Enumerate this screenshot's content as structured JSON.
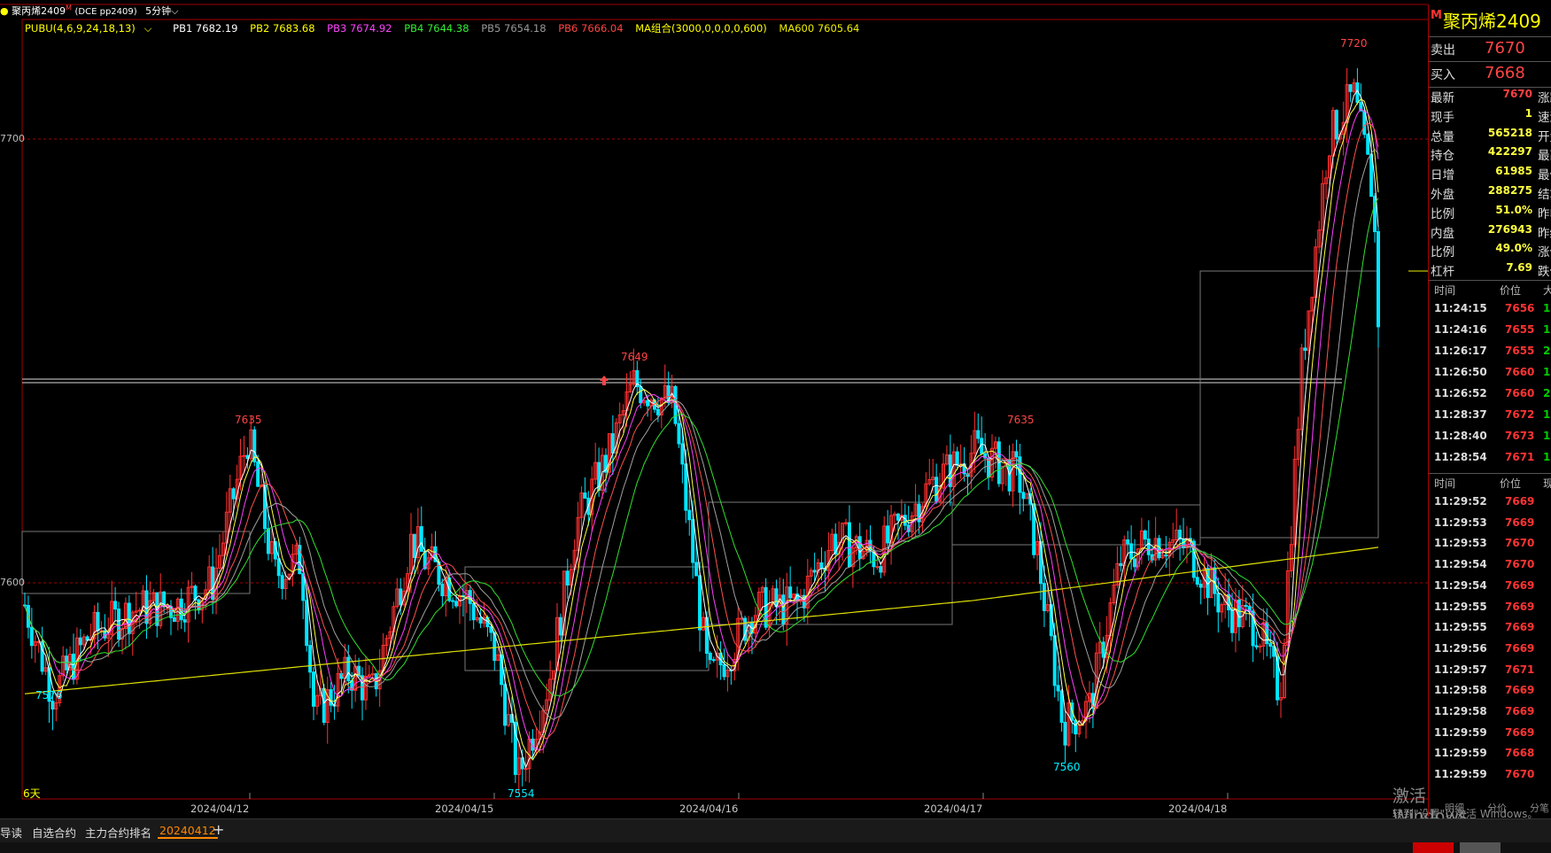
{
  "header": {
    "symbol_title": "聚丙烯2409",
    "code": "(DCE pp2409)",
    "period": "5分钟"
  },
  "indicator_bar": {
    "name": "PUBU(4,6,9,24,18,13)",
    "pb1": "PB1 7682.19",
    "pb2": "PB2 7683.68",
    "pb3": "PB3 7674.92",
    "pb4": "PB4 7644.38",
    "pb5": "PB5 7654.18",
    "pb6": "PB6 7666.04",
    "ma_combo": "MA组合(3000,0,0,0,0,600)",
    "ma600": "MA600 7605.64"
  },
  "colors": {
    "up": "#ff3030",
    "down": "#00e5ff",
    "pb1": "#ffffff",
    "pb2": "#ffff40",
    "pb3": "#ff40ff",
    "pb4": "#30e030",
    "pb5": "#a0a0a0",
    "pb6": "#ff5050",
    "ma600": "#e0e000",
    "grid_red": "#a00000"
  },
  "chart": {
    "y_labels": [
      "7700",
      "7600"
    ],
    "x_labels": [
      "2024/04/12",
      "2024/04/15",
      "2024/04/16",
      "2024/04/17",
      "2024/04/18"
    ],
    "annotations": [
      {
        "text": "7720",
        "color": "#ff4040"
      },
      {
        "text": "7649",
        "color": "#ff4040"
      },
      {
        "text": "7635",
        "color": "#ff4040"
      },
      {
        "text": "7635",
        "color": "#ff4040"
      },
      {
        "text": "7576",
        "color": "#00e5ff"
      },
      {
        "text": "7554",
        "color": "#00e5ff"
      },
      {
        "text": "7560",
        "color": "#00e5ff"
      }
    ],
    "span_label": "6天"
  },
  "chart_data": {
    "type": "candlestick",
    "instrument": "聚丙烯2409",
    "interval": "5分钟",
    "y_ticks": [
      7600,
      7700
    ],
    "x_ticks": [
      "2024/04/12",
      "2024/04/15",
      "2024/04/16",
      "2024/04/17",
      "2024/04/18"
    ],
    "marked_extremes": {
      "high": [
        7720,
        7649,
        7635,
        7635
      ],
      "low": [
        7576,
        7554,
        7560
      ]
    },
    "series": [
      {
        "name": "PB1",
        "last": 7682.19
      },
      {
        "name": "PB2",
        "last": 7683.68
      },
      {
        "name": "PB3",
        "last": 7674.92
      },
      {
        "name": "PB4",
        "last": 7644.38
      },
      {
        "name": "PB5",
        "last": 7654.18
      },
      {
        "name": "PB6",
        "last": 7666.04
      },
      {
        "name": "MA600",
        "last": 7605.64
      }
    ],
    "grid": false
  },
  "panel": {
    "title": "聚丙烯2409",
    "badge": "M",
    "sell_label": "卖出",
    "sell_value": "7670",
    "buy_label": "买入",
    "buy_value": "7668",
    "stats": [
      {
        "k": "最新",
        "v": "7670",
        "c": "#ff4040",
        "r": "涨跌"
      },
      {
        "k": "现手",
        "v": "1",
        "c": "#ffff40",
        "r": "速涨"
      },
      {
        "k": "总量",
        "v": "565218",
        "c": "#ffff40",
        "r": "开盘"
      },
      {
        "k": "持仓",
        "v": "422297",
        "c": "#ffff40",
        "r": "最高"
      },
      {
        "k": "日增",
        "v": "61985",
        "c": "#ffff40",
        "r": "最低"
      },
      {
        "k": "外盘",
        "v": "288275",
        "c": "#ffff40",
        "r": "结算"
      },
      {
        "k": "比例",
        "v": "51.0%",
        "c": "#ffff40",
        "r": "昨收"
      },
      {
        "k": "内盘",
        "v": "276943",
        "c": "#ffff40",
        "r": "昨结"
      },
      {
        "k": "比例",
        "v": "49.0%",
        "c": "#ffff40",
        "r": "涨停"
      },
      {
        "k": "杠杆",
        "v": "7.69",
        "c": "#ffff40",
        "r": "跌停"
      }
    ],
    "ticks1_header": {
      "t": "时间",
      "p": "价位",
      "q": "大"
    },
    "ticks1": [
      {
        "t": "11:24:15",
        "p": "7656",
        "q": "1"
      },
      {
        "t": "11:24:16",
        "p": "7655",
        "q": "1"
      },
      {
        "t": "11:26:17",
        "p": "7655",
        "q": "2"
      },
      {
        "t": "11:26:50",
        "p": "7660",
        "q": "1"
      },
      {
        "t": "11:26:52",
        "p": "7660",
        "q": "2"
      },
      {
        "t": "11:28:37",
        "p": "7672",
        "q": "1"
      },
      {
        "t": "11:28:40",
        "p": "7673",
        "q": "1"
      },
      {
        "t": "11:28:54",
        "p": "7671",
        "q": "1"
      }
    ],
    "ticks2_header": {
      "t": "时间",
      "p": "价位",
      "q": "现"
    },
    "ticks2": [
      {
        "t": "11:29:52",
        "p": "7669"
      },
      {
        "t": "11:29:53",
        "p": "7669"
      },
      {
        "t": "11:29:53",
        "p": "7670"
      },
      {
        "t": "11:29:54",
        "p": "7670"
      },
      {
        "t": "11:29:54",
        "p": "7669"
      },
      {
        "t": "11:29:55",
        "p": "7669"
      },
      {
        "t": "11:29:55",
        "p": "7669"
      },
      {
        "t": "11:29:56",
        "p": "7669"
      },
      {
        "t": "11:29:57",
        "p": "7671"
      },
      {
        "t": "11:29:58",
        "p": "7669"
      },
      {
        "t": "11:29:58",
        "p": "7669"
      },
      {
        "t": "11:29:59",
        "p": "7669"
      },
      {
        "t": "11:29:59",
        "p": "7668"
      },
      {
        "t": "11:29:59",
        "p": "7670"
      }
    ],
    "bottom_labels": [
      "明细",
      "分价",
      "分笔"
    ]
  },
  "tabs": [
    "导读",
    "自选合约",
    "主力合约排名",
    "20240412",
    "+"
  ],
  "watermark": {
    "line1": "激活 Windows",
    "line2": "转到\"设置\"以激活 Windows。"
  }
}
